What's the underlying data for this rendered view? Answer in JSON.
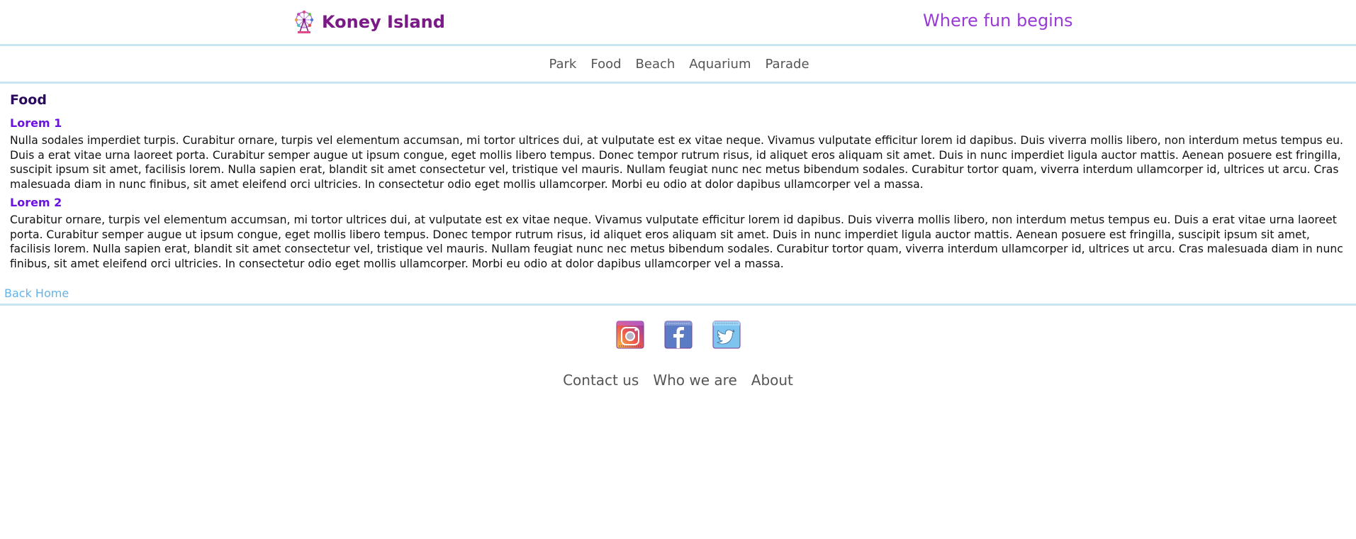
{
  "header": {
    "brand_title": "Koney Island",
    "brand_icon": "ferris-wheel-icon",
    "tagline": "Where fun begins"
  },
  "nav": {
    "items": [
      {
        "label": "Park"
      },
      {
        "label": "Food"
      },
      {
        "label": "Beach"
      },
      {
        "label": "Aquarium"
      },
      {
        "label": "Parade"
      }
    ]
  },
  "main": {
    "title": "Food",
    "sections": [
      {
        "title": "Lorem 1",
        "body": "Nulla sodales imperdiet turpis. Curabitur ornare, turpis vel elementum accumsan, mi tortor ultrices dui, at vulputate est ex vitae neque. Vivamus vulputate efficitur lorem id dapibus. Duis viverra mollis libero, non interdum metus tempus eu. Duis a erat vitae urna laoreet porta. Curabitur semper augue ut ipsum congue, eget mollis libero tempus. Donec tempor rutrum risus, id aliquet eros aliquam sit amet. Duis in nunc imperdiet ligula auctor mattis. Aenean posuere est fringilla, suscipit ipsum sit amet, facilisis lorem. Nulla sapien erat, blandit sit amet consectetur vel, tristique vel mauris. Nullam feugiat nunc nec metus bibendum sodales. Curabitur tortor quam, viverra interdum ullamcorper id, ultrices ut arcu. Cras malesuada diam in nunc finibus, sit amet eleifend orci ultricies. In consectetur odio eget mollis ullamcorper. Morbi eu odio at dolor dapibus ullamcorper vel a massa."
      },
      {
        "title": "Lorem 2",
        "body": "Curabitur ornare, turpis vel elementum accumsan, mi tortor ultrices dui, at vulputate est ex vitae neque. Vivamus vulputate efficitur lorem id dapibus. Duis viverra mollis libero, non interdum metus tempus eu. Duis a erat vitae urna laoreet porta. Curabitur semper augue ut ipsum congue, eget mollis libero tempus. Donec tempor rutrum risus, id aliquet eros aliquam sit amet. Duis in nunc imperdiet ligula auctor mattis. Aenean posuere est fringilla, suscipit ipsum sit amet, facilisis lorem. Nulla sapien erat, blandit sit amet consectetur vel, tristique vel mauris. Nullam feugiat nunc nec metus bibendum sodales. Curabitur tortor quam, viverra interdum ullamcorper id, ultrices ut arcu. Cras malesuada diam in nunc finibus, sit amet eleifend orci ultricies. In consectetur odio eget mollis ullamcorper. Morbi eu odio at dolor dapibus ullamcorper vel a massa."
      }
    ],
    "back_home_label": "Back Home"
  },
  "footer": {
    "social": [
      {
        "icon": "instagram-icon"
      },
      {
        "icon": "facebook-icon"
      },
      {
        "icon": "twitter-icon"
      }
    ],
    "links": [
      {
        "label": "Contact us"
      },
      {
        "label": "Who we are"
      },
      {
        "label": "About"
      }
    ]
  },
  "colors": {
    "brand": "#7a1a86",
    "tagline": "#9a3ad6",
    "page_title": "#2a0a5c",
    "section_title": "#6a12e0",
    "link": "#63b3ea",
    "rule": "#c8e6f2",
    "nav_text": "#555555"
  }
}
